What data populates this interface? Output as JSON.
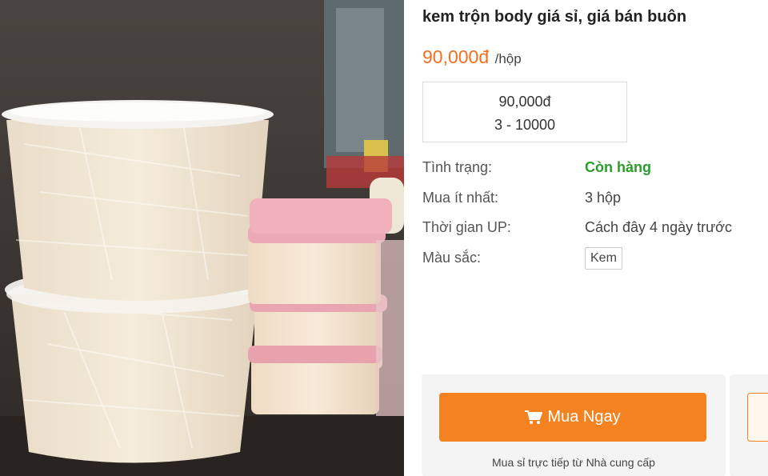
{
  "product": {
    "title": "kem trộn body giá sỉ, giá bán buôn",
    "price": "90,000đ",
    "unit": "/hộp",
    "price_tier": {
      "price": "90,000đ",
      "range": "3 - 10000"
    }
  },
  "attributes": [
    {
      "label": "Tình trạng:",
      "value": "Còn hàng"
    },
    {
      "label": "Mua ít nhất:",
      "value": "3 hộp"
    },
    {
      "label": "Thời gian UP:",
      "value": "Cách đây 4 ngày trước"
    },
    {
      "label": "Màu sắc:",
      "value": "Kem"
    }
  ],
  "buy": {
    "button_label": "Mua Ngay",
    "button_icon": "cart-icon",
    "note": "Mua sỉ trực tiếp từ Nhà cung cấp"
  },
  "colors": {
    "price": "#f26f21",
    "button": "#f58220",
    "in_stock": "#2a9d2a"
  }
}
